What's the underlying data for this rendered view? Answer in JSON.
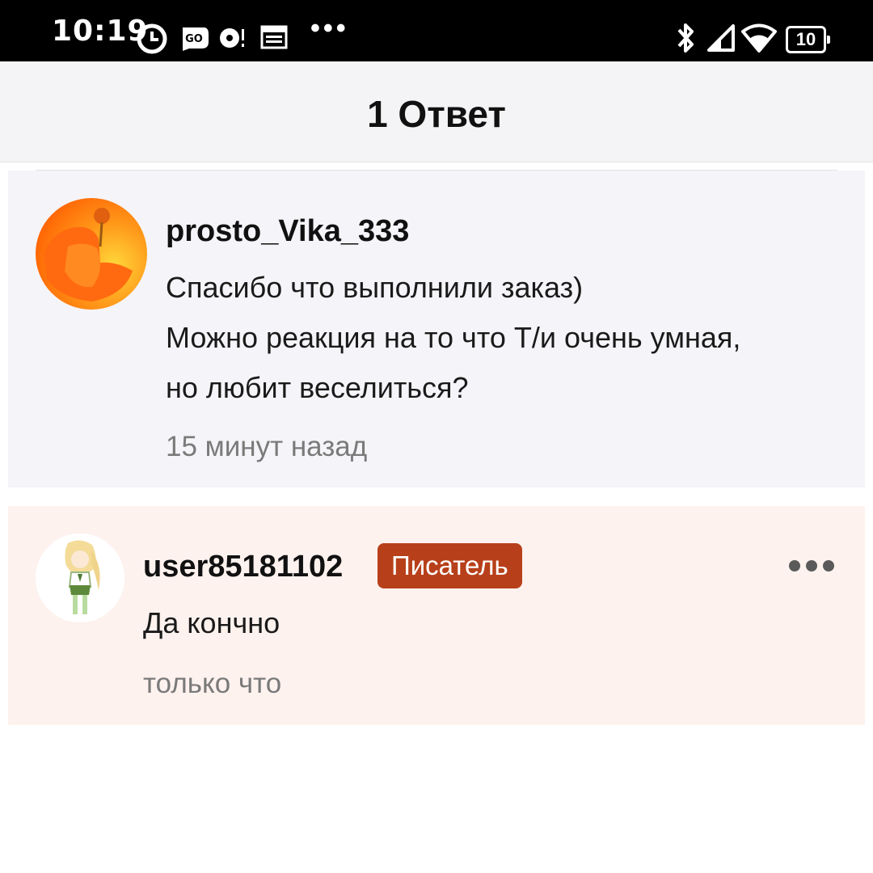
{
  "status_bar": {
    "time": "10:19",
    "icons": [
      "clock-icon",
      "go-icon",
      "notification-icon",
      "calendar-icon",
      "more-dots-icon",
      "bluetooth-icon",
      "signal-icon",
      "wifi-icon",
      "battery-icon"
    ],
    "dots": "•••",
    "battery_level": "10"
  },
  "header": {
    "title": "1 Ответ"
  },
  "comments": [
    {
      "username": "prosto_Vika_333",
      "text": "Спасибо что выполнили заказ)\nМожно реакция на то что Т/и очень умная,\nно любит веселиться?",
      "time": "15 минут назад",
      "avatar_icon": "user-avatar-flower-hand"
    },
    {
      "username": "user85181102",
      "badge": "Писатель",
      "text": "Да кончно",
      "time": "только что",
      "avatar_icon": "user-avatar-character",
      "more_icon": "more-options-icon"
    }
  ],
  "colors": {
    "status_bar_bg": "#000000",
    "header_bg": "#f4f4f6",
    "card_1_bg": "#f5f4f8",
    "card_2_bg": "#fdf2ee",
    "badge_bg": "#b7401a",
    "timestamp": "#7a7a7a"
  }
}
